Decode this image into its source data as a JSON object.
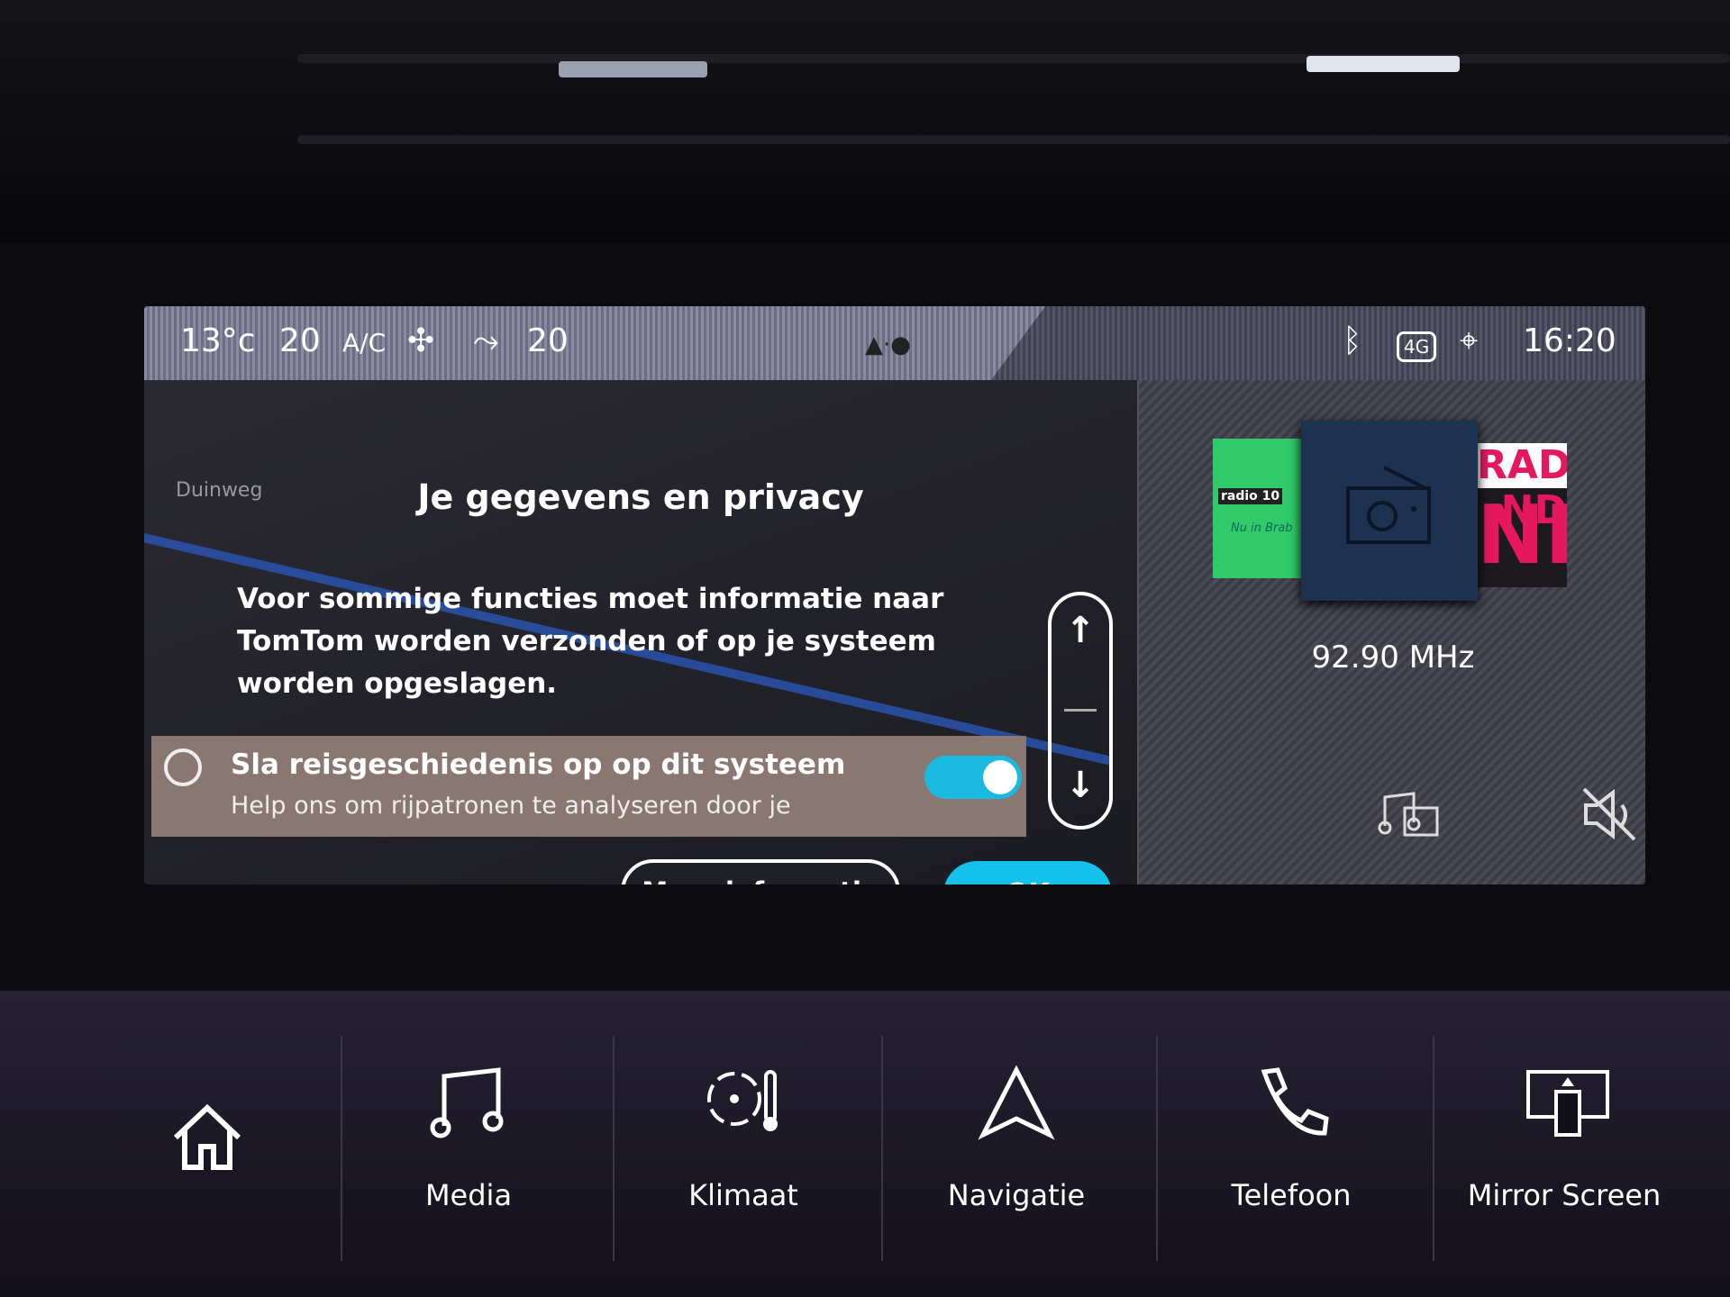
{
  "status": {
    "outside_temp": "13°c",
    "left_temp": "20",
    "ac": "A/C",
    "right_temp": "20",
    "time": "16:20",
    "network": "4G"
  },
  "dialog": {
    "title": "Je gegevens en privacy",
    "body": "Voor sommige functies moet informatie naar TomTom worden verzonden of op je systeem worden opgeslagen.",
    "setting": {
      "title": "Sla reisgeschiedenis op op dit systeem",
      "subtitle": "Help ons om rijpatronen te analyseren door je",
      "enabled": true
    },
    "more_label": "Meer informatie",
    "ok_label": "OK",
    "map_label": "Duinweg"
  },
  "radio": {
    "frequency": "92.90 MHz",
    "stations": [
      {
        "logo": "radio 10",
        "tagline": "Nu in Brab"
      },
      {
        "logo": "radio-icon"
      },
      {
        "logo": "RADIO ND"
      }
    ]
  },
  "nav": {
    "items": [
      {
        "label": "",
        "icon": "home-icon"
      },
      {
        "label": "Media",
        "icon": "music-note-icon"
      },
      {
        "label": "Klimaat",
        "icon": "fan-thermometer-icon"
      },
      {
        "label": "Navigatie",
        "icon": "navigation-arrow-icon"
      },
      {
        "label": "Telefoon",
        "icon": "phone-icon"
      },
      {
        "label": "Mirror Screen",
        "icon": "mirror-screen-icon"
      }
    ]
  },
  "colors": {
    "accent": "#14c1eb",
    "toggle_row": "#8b7771"
  }
}
